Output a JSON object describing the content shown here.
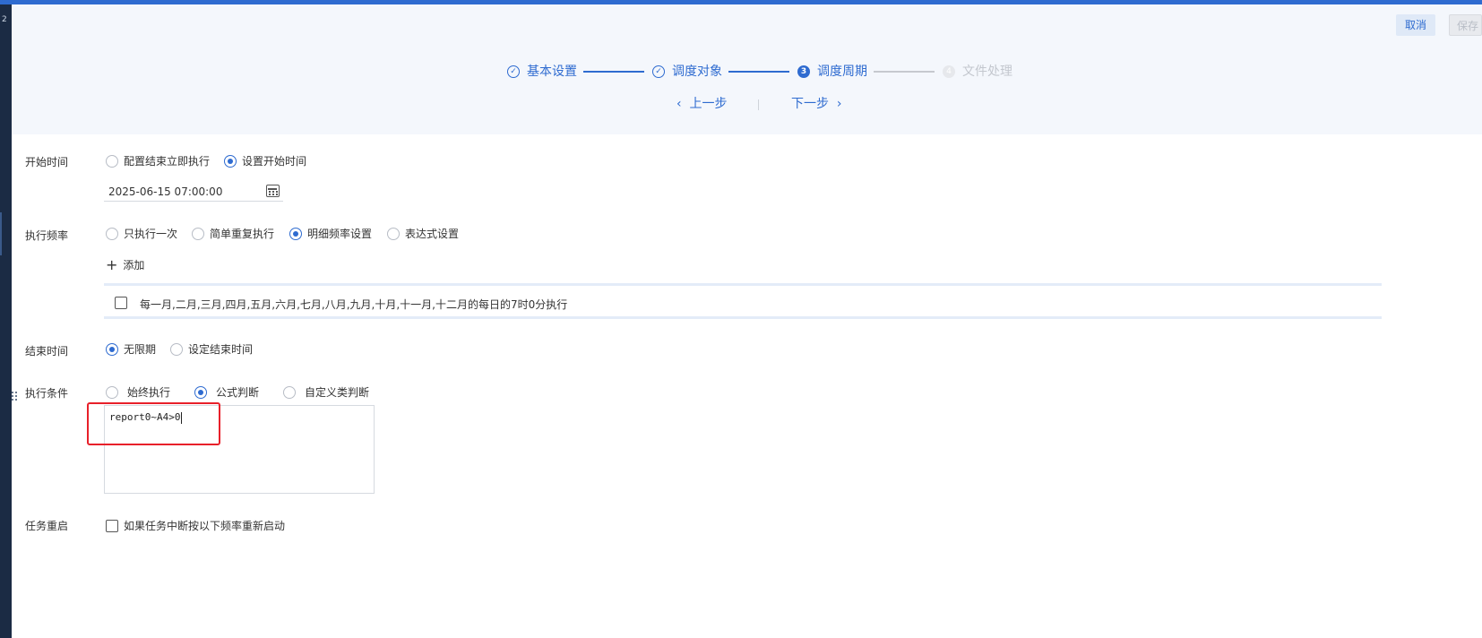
{
  "toolbar": {
    "cancel_label": "取消",
    "save_label": "保存"
  },
  "steps": [
    {
      "index": "1",
      "label": "基本设置",
      "state": "done"
    },
    {
      "index": "2",
      "label": "调度对象",
      "state": "done"
    },
    {
      "index": "3",
      "label": "调度周期",
      "state": "active"
    },
    {
      "index": "4",
      "label": "文件处理",
      "state": "todo"
    }
  ],
  "nav": {
    "prev_label": "上一步",
    "next_label": "下一步"
  },
  "start_time": {
    "label": "开始时间",
    "options": [
      "配置结束立即执行",
      "设置开始时间"
    ],
    "selected": "设置开始时间",
    "value": "2025-06-15 07:00:00"
  },
  "frequency": {
    "label": "执行频率",
    "options": [
      "只执行一次",
      "简单重复执行",
      "明细频率设置",
      "表达式设置"
    ],
    "selected": "明细频率设置",
    "add_label": "添加",
    "rules": [
      "每一月,二月,三月,四月,五月,六月,七月,八月,九月,十月,十一月,十二月的每日的7时0分执行"
    ]
  },
  "end_time": {
    "label": "结束时间",
    "options": [
      "无限期",
      "设定结束时间"
    ],
    "selected": "无限期"
  },
  "condition": {
    "label": "执行条件",
    "options": [
      "始终执行",
      "公式判断",
      "自定义类判断"
    ],
    "selected": "公式判断",
    "formula": "report0~A4>0"
  },
  "restart": {
    "label": "任务重启",
    "checkbox_label": "如果任务中断按以下频率重新启动"
  },
  "colors": {
    "accent": "#2e6bd0",
    "highlight": "#e8202a"
  },
  "icons": [
    "check-circle-icon",
    "chevron-left-icon",
    "chevron-right-icon",
    "calendar-icon",
    "plus-icon",
    "drag-handle-icon"
  ]
}
